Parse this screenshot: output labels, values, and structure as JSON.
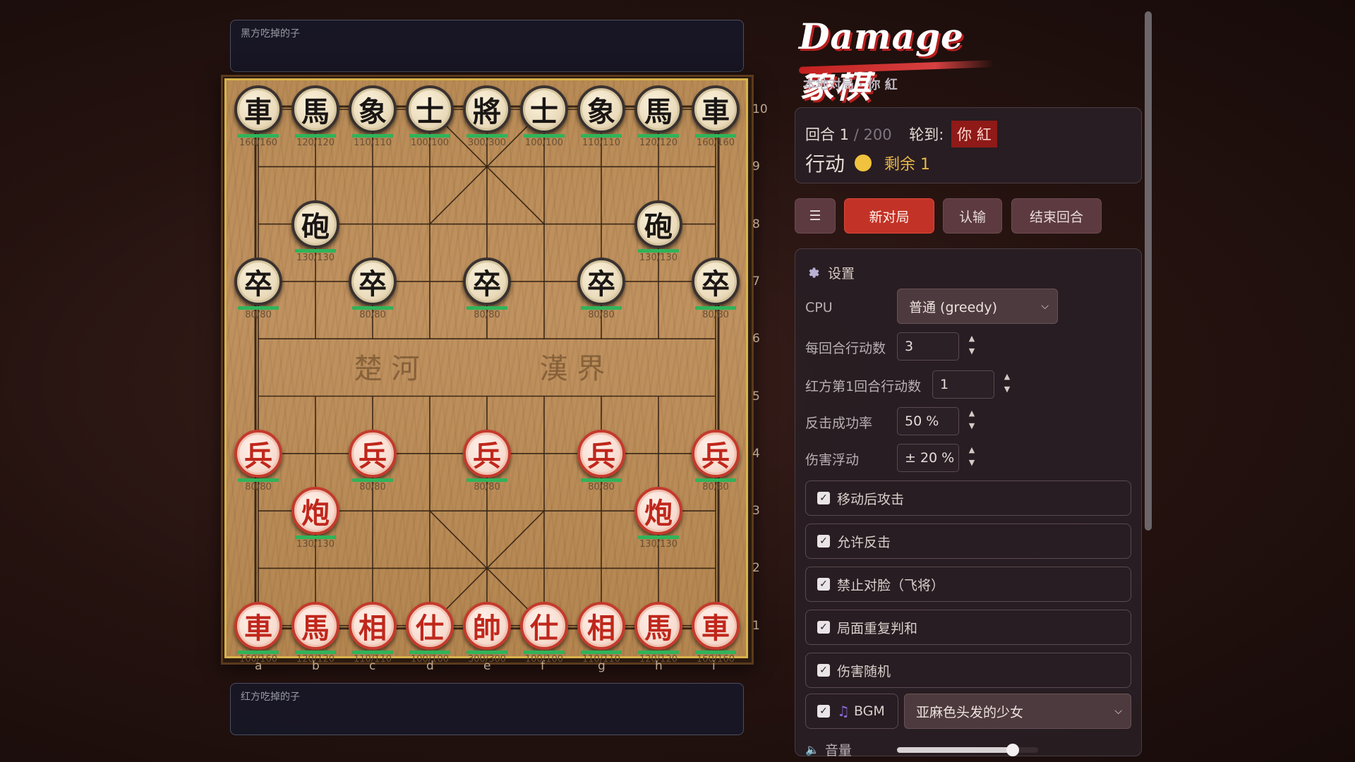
{
  "captured": {
    "black_label": "黑方吃掉的子",
    "red_label": "红方吃掉的子"
  },
  "board": {
    "files": [
      "a",
      "b",
      "c",
      "d",
      "e",
      "f",
      "g",
      "h",
      "i"
    ],
    "ranks": [
      "10",
      "9",
      "8",
      "7",
      "6",
      "5",
      "4",
      "3",
      "2",
      "1"
    ],
    "river_left": "楚 河",
    "river_right": "漢 界",
    "pieces": [
      {
        "side": "black",
        "char": "車",
        "file": 0,
        "rank": 10,
        "hp": 160,
        "max": 160
      },
      {
        "side": "black",
        "char": "馬",
        "file": 1,
        "rank": 10,
        "hp": 120,
        "max": 120
      },
      {
        "side": "black",
        "char": "象",
        "file": 2,
        "rank": 10,
        "hp": 110,
        "max": 110
      },
      {
        "side": "black",
        "char": "士",
        "file": 3,
        "rank": 10,
        "hp": 100,
        "max": 100
      },
      {
        "side": "black",
        "char": "將",
        "file": 4,
        "rank": 10,
        "hp": 300,
        "max": 300
      },
      {
        "side": "black",
        "char": "士",
        "file": 5,
        "rank": 10,
        "hp": 100,
        "max": 100
      },
      {
        "side": "black",
        "char": "象",
        "file": 6,
        "rank": 10,
        "hp": 110,
        "max": 110
      },
      {
        "side": "black",
        "char": "馬",
        "file": 7,
        "rank": 10,
        "hp": 120,
        "max": 120
      },
      {
        "side": "black",
        "char": "車",
        "file": 8,
        "rank": 10,
        "hp": 160,
        "max": 160
      },
      {
        "side": "black",
        "char": "砲",
        "file": 1,
        "rank": 8,
        "hp": 130,
        "max": 130
      },
      {
        "side": "black",
        "char": "砲",
        "file": 7,
        "rank": 8,
        "hp": 130,
        "max": 130
      },
      {
        "side": "black",
        "char": "卒",
        "file": 0,
        "rank": 7,
        "hp": 80,
        "max": 80
      },
      {
        "side": "black",
        "char": "卒",
        "file": 2,
        "rank": 7,
        "hp": 80,
        "max": 80
      },
      {
        "side": "black",
        "char": "卒",
        "file": 4,
        "rank": 7,
        "hp": 80,
        "max": 80
      },
      {
        "side": "black",
        "char": "卒",
        "file": 6,
        "rank": 7,
        "hp": 80,
        "max": 80
      },
      {
        "side": "black",
        "char": "卒",
        "file": 8,
        "rank": 7,
        "hp": 80,
        "max": 80
      },
      {
        "side": "red",
        "char": "兵",
        "file": 0,
        "rank": 4,
        "hp": 80,
        "max": 80
      },
      {
        "side": "red",
        "char": "兵",
        "file": 2,
        "rank": 4,
        "hp": 80,
        "max": 80
      },
      {
        "side": "red",
        "char": "兵",
        "file": 4,
        "rank": 4,
        "hp": 80,
        "max": 80
      },
      {
        "side": "red",
        "char": "兵",
        "file": 6,
        "rank": 4,
        "hp": 80,
        "max": 80
      },
      {
        "side": "red",
        "char": "兵",
        "file": 8,
        "rank": 4,
        "hp": 80,
        "max": 80
      },
      {
        "side": "red",
        "char": "炮",
        "file": 1,
        "rank": 3,
        "hp": 130,
        "max": 130
      },
      {
        "side": "red",
        "char": "炮",
        "file": 7,
        "rank": 3,
        "hp": 130,
        "max": 130
      },
      {
        "side": "red",
        "char": "車",
        "file": 0,
        "rank": 1,
        "hp": 160,
        "max": 160
      },
      {
        "side": "red",
        "char": "馬",
        "file": 1,
        "rank": 1,
        "hp": 120,
        "max": 120
      },
      {
        "side": "red",
        "char": "相",
        "file": 2,
        "rank": 1,
        "hp": 110,
        "max": 110
      },
      {
        "side": "red",
        "char": "仕",
        "file": 3,
        "rank": 1,
        "hp": 100,
        "max": 100
      },
      {
        "side": "red",
        "char": "帥",
        "file": 4,
        "rank": 1,
        "hp": 300,
        "max": 300
      },
      {
        "side": "red",
        "char": "仕",
        "file": 5,
        "rank": 1,
        "hp": 100,
        "max": 100
      },
      {
        "side": "red",
        "char": "相",
        "file": 6,
        "rank": 1,
        "hp": 110,
        "max": 110
      },
      {
        "side": "red",
        "char": "馬",
        "file": 7,
        "rank": 1,
        "hp": 120,
        "max": 120
      },
      {
        "side": "red",
        "char": "車",
        "file": 8,
        "rank": 1,
        "hp": 160,
        "max": 160
      }
    ]
  },
  "header": {
    "logo": "Damage象棋",
    "subtitle": "本地对局 · 你 紅"
  },
  "status": {
    "round_label": "回合 1",
    "round_max": "/ 200",
    "turn_label": "轮到:",
    "turn_value": "你 紅",
    "action_label": "行动",
    "remain": "剩余 1"
  },
  "toolbar": {
    "menu_icon": "☰",
    "new_game": "新对局",
    "resign": "认输",
    "end_turn": "结束回合"
  },
  "settings": {
    "title": "设置",
    "cpu_label": "CPU",
    "cpu_value": "普通 (greedy)",
    "actions_label": "每回合行动数",
    "actions_value": "3",
    "red_first_label": "红方第1回合行动数",
    "red_first_value": "1",
    "counter_rate_label": "反击成功率",
    "counter_rate_value": "50 %",
    "damage_var_label": "伤害浮动",
    "damage_var_value": "± 20 %",
    "checks": [
      {
        "label": "移动后攻击",
        "checked": true
      },
      {
        "label": "允许反击",
        "checked": true
      },
      {
        "label": "禁止对脸（飞将）",
        "checked": true
      },
      {
        "label": "局面重复判和",
        "checked": true
      },
      {
        "label": "伤害随机",
        "checked": true
      }
    ],
    "bgm_label": "BGM",
    "bgm_track": "亚麻色头发的少女",
    "volume_label": "音量",
    "volume": 0.82
  },
  "colors": {
    "accent_red": "#c33226",
    "hp_green": "#2fb45a",
    "turn_dot": "#f0c23e"
  }
}
